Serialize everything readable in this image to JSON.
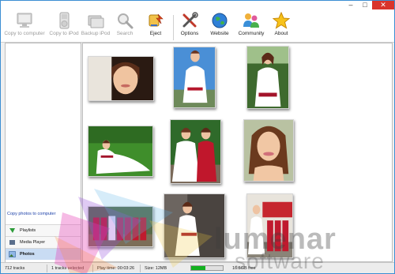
{
  "window": {
    "controls": [
      "–",
      "□",
      "✕"
    ]
  },
  "toolbar": {
    "items": [
      {
        "label": "Copy to computer",
        "icon": "computer-icon",
        "enabled": false
      },
      {
        "label": "Copy to iPod",
        "icon": "ipod-icon",
        "enabled": false
      },
      {
        "label": "Backup iPod",
        "icon": "backup-icon",
        "enabled": false
      },
      {
        "label": "Search",
        "icon": "search-icon",
        "enabled": false
      },
      {
        "label": "Eject",
        "icon": "eject-icon",
        "enabled": true
      },
      {
        "label": "Options",
        "icon": "tools-icon",
        "enabled": true
      },
      {
        "label": "Website",
        "icon": "globe-icon",
        "enabled": true
      },
      {
        "label": "Community",
        "icon": "people-icon",
        "enabled": true
      },
      {
        "label": "About",
        "icon": "star-icon",
        "enabled": true
      }
    ]
  },
  "sidebar": {
    "copy_link": "Copy photos to computer",
    "sources": [
      {
        "label": "Playlists",
        "icon": "playlist-icon",
        "selected": false
      },
      {
        "label": "Media Player",
        "icon": "media-player-icon",
        "selected": false
      },
      {
        "label": "Photos",
        "icon": "photos-icon",
        "selected": true
      }
    ]
  },
  "photos": [
    {
      "subject": "bride-portrait-closeup"
    },
    {
      "subject": "bride-standing-blue-sky"
    },
    {
      "subject": "bride-red-sash-trees"
    },
    {
      "subject": "bride-sitting-grass"
    },
    {
      "subject": "bride-and-bridesmaid"
    },
    {
      "subject": "smiling-woman-portrait"
    },
    {
      "subject": "bridal-party-group"
    },
    {
      "subject": "bride-by-building"
    },
    {
      "subject": "bride-with-bridesmaids-red"
    }
  ],
  "status": {
    "tracks": "712 tracks",
    "selected": "1 tracks selected",
    "play_time": "Play time: 00:03:26",
    "size": "Size: 12MB",
    "progress_fraction": 0.45,
    "free": "16.5GB free"
  },
  "watermark": {
    "line1": "lumenar",
    "line2": "software"
  },
  "colors": {
    "accent": "#3c8fd3",
    "close": "#d9342b",
    "progress": "#13b11f",
    "link": "#1a3fa8",
    "selection": "#c9dcf3"
  }
}
